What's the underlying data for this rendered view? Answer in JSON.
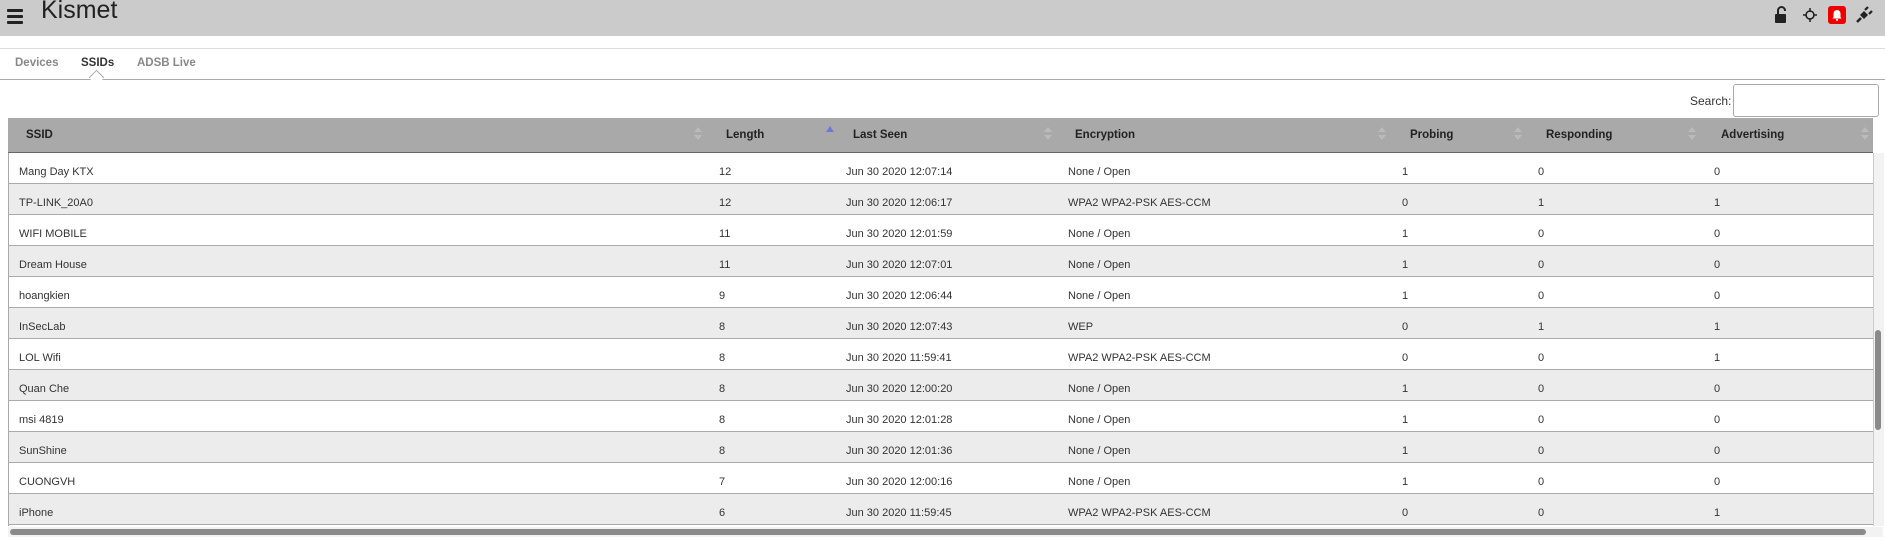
{
  "app": {
    "title": "Kismet"
  },
  "header_icons": [
    "lock-open-icon",
    "crosshair-icon",
    "alert-bell-icon",
    "power-plug-icon"
  ],
  "tabs": [
    {
      "label": "Devices",
      "active": false
    },
    {
      "label": "SSIDs",
      "active": true
    },
    {
      "label": "ADSB Live",
      "active": false
    }
  ],
  "search": {
    "label": "Search:",
    "value": ""
  },
  "table": {
    "columns": [
      "SSID",
      "Length",
      "Last Seen",
      "Encryption",
      "Probing",
      "Responding",
      "Advertising"
    ],
    "sorted_column": "Length",
    "rows": [
      {
        "ssid": "Mang Day KTX",
        "length": "12",
        "last_seen": "Jun 30 2020 12:07:14",
        "encryption": "None / Open",
        "probing": "1",
        "responding": "0",
        "advertising": "0"
      },
      {
        "ssid": "TP-LINK_20A0",
        "length": "12",
        "last_seen": "Jun 30 2020 12:06:17",
        "encryption": "WPA2 WPA2-PSK AES-CCM",
        "probing": "0",
        "responding": "1",
        "advertising": "1"
      },
      {
        "ssid": "WIFI MOBILE",
        "length": "11",
        "last_seen": "Jun 30 2020 12:01:59",
        "encryption": "None / Open",
        "probing": "1",
        "responding": "0",
        "advertising": "0"
      },
      {
        "ssid": "Dream House",
        "length": "11",
        "last_seen": "Jun 30 2020 12:07:01",
        "encryption": "None / Open",
        "probing": "1",
        "responding": "0",
        "advertising": "0"
      },
      {
        "ssid": "hoangkien",
        "length": "9",
        "last_seen": "Jun 30 2020 12:06:44",
        "encryption": "None / Open",
        "probing": "1",
        "responding": "0",
        "advertising": "0"
      },
      {
        "ssid": "InSecLab",
        "length": "8",
        "last_seen": "Jun 30 2020 12:07:43",
        "encryption": "WEP",
        "probing": "0",
        "responding": "1",
        "advertising": "1"
      },
      {
        "ssid": "LOL Wifi",
        "length": "8",
        "last_seen": "Jun 30 2020 11:59:41",
        "encryption": "WPA2 WPA2-PSK AES-CCM",
        "probing": "0",
        "responding": "0",
        "advertising": "1"
      },
      {
        "ssid": "Quan Che",
        "length": "8",
        "last_seen": "Jun 30 2020 12:00:20",
        "encryption": "None / Open",
        "probing": "1",
        "responding": "0",
        "advertising": "0"
      },
      {
        "ssid": "msi 4819",
        "length": "8",
        "last_seen": "Jun 30 2020 12:01:28",
        "encryption": "None / Open",
        "probing": "1",
        "responding": "0",
        "advertising": "0"
      },
      {
        "ssid": "SunShine",
        "length": "8",
        "last_seen": "Jun 30 2020 12:01:36",
        "encryption": "None / Open",
        "probing": "1",
        "responding": "0",
        "advertising": "0"
      },
      {
        "ssid": "CUONGVH",
        "length": "7",
        "last_seen": "Jun 30 2020 12:00:16",
        "encryption": "None / Open",
        "probing": "1",
        "responding": "0",
        "advertising": "0"
      },
      {
        "ssid": "iPhone",
        "length": "6",
        "last_seen": "Jun 30 2020 11:59:45",
        "encryption": "WPA2 WPA2-PSK AES-CCM",
        "probing": "0",
        "responding": "0",
        "advertising": "1"
      }
    ]
  },
  "colors": {
    "topbar": "#cbcbcb",
    "header": "#a9a9a9",
    "alert": "#ee0000",
    "sort_active": "#6a7bd4"
  }
}
